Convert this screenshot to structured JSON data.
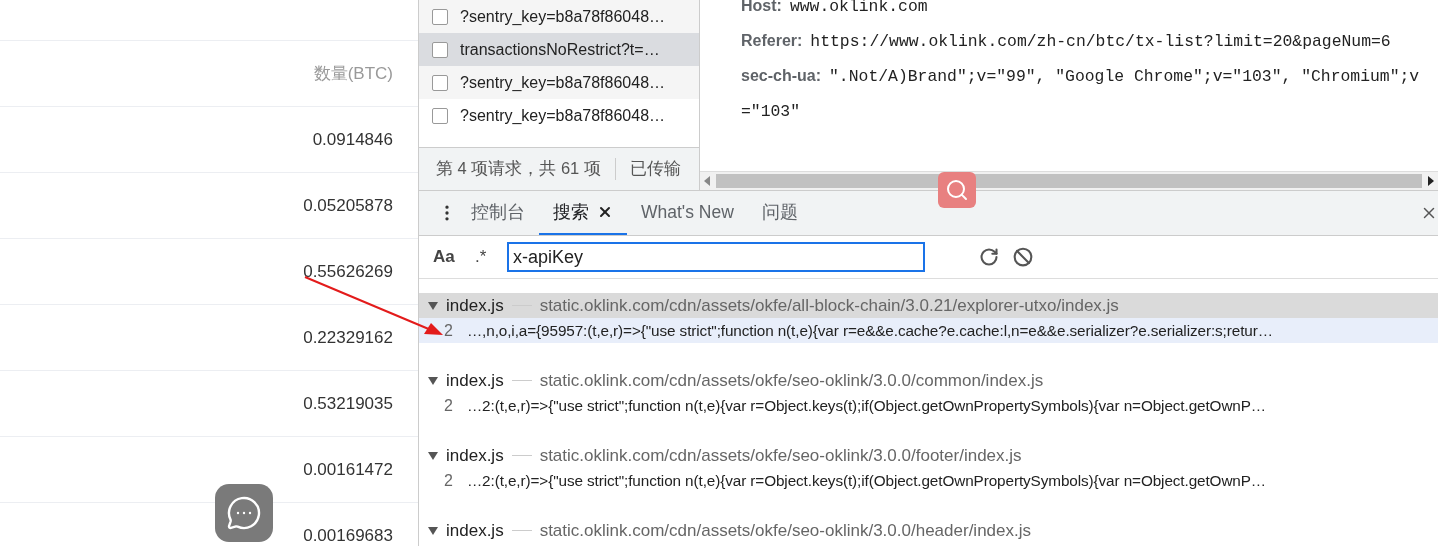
{
  "amount_table": {
    "header": "数量(BTC)",
    "rows": [
      "0.0914846",
      "0.05205878",
      "0.55626269",
      "0.22329162",
      "0.53219035",
      "0.00161472",
      "0.00169683"
    ]
  },
  "requests": {
    "items": [
      {
        "name": "?sentry_key=b8a78f86048…",
        "selected": false,
        "checked": false
      },
      {
        "name": "transactionsNoRestrict?t=…",
        "selected": true,
        "checked": false
      },
      {
        "name": "?sentry_key=b8a78f86048…",
        "selected": false,
        "checked": false
      },
      {
        "name": "?sentry_key=b8a78f86048…",
        "selected": false,
        "checked": false
      }
    ],
    "status": "第 4 项请求，共 61 项",
    "transferred": "已传输"
  },
  "headers": [
    {
      "name": "Host:",
      "value": "www.oklink.com"
    },
    {
      "name": "Referer:",
      "value": "https://www.oklink.com/zh-cn/btc/tx-list?limit=20&pageNum=6"
    },
    {
      "name": "sec-ch-ua:",
      "value": "\".Not/A)Brand\";v=\"99\", \"Google Chrome\";v=\"103\", \"Chromium\";v=\"103\""
    }
  ],
  "drawer_tabs": [
    {
      "label": "控制台",
      "selected": false,
      "closable": false
    },
    {
      "label": "搜索",
      "selected": true,
      "closable": true
    },
    {
      "label": "What's New",
      "selected": false,
      "closable": false
    },
    {
      "label": "问题",
      "selected": false,
      "closable": false
    }
  ],
  "search": {
    "match_case": "Aa",
    "regex": ".*",
    "value": "x-apiKey"
  },
  "results": [
    {
      "file": "index.js",
      "path": "static.oklink.com/cdn/assets/okfe/all-block-chain/3.0.21/explorer-utxo/index.js",
      "selected": true,
      "matches": [
        {
          "line": "2",
          "text": "…,n,o,i,a={95957:(t,e,r)=>{\"use strict\";function n(t,e){var r=e&&e.cache?e.cache:l,n=e&&e.serializer?e.serializer:s;retur…",
          "selected": true
        }
      ]
    },
    {
      "file": "index.js",
      "path": "static.oklink.com/cdn/assets/okfe/seo-oklink/3.0.0/common/index.js",
      "selected": false,
      "matches": [
        {
          "line": "2",
          "text": "…2:(t,e,r)=>{\"use strict\";function n(t,e){var r=Object.keys(t);if(Object.getOwnPropertySymbols){var n=Object.getOwnP…",
          "selected": false
        }
      ]
    },
    {
      "file": "index.js",
      "path": "static.oklink.com/cdn/assets/okfe/seo-oklink/3.0.0/footer/index.js",
      "selected": false,
      "matches": [
        {
          "line": "2",
          "text": "…2:(t,e,r)=>{\"use strict\";function n(t,e){var r=Object.keys(t);if(Object.getOwnPropertySymbols){var n=Object.getOwnP…",
          "selected": false
        }
      ]
    },
    {
      "file": "index.js",
      "path": "static.oklink.com/cdn/assets/okfe/seo-oklink/3.0.0/header/index.js",
      "selected": false
    }
  ]
}
